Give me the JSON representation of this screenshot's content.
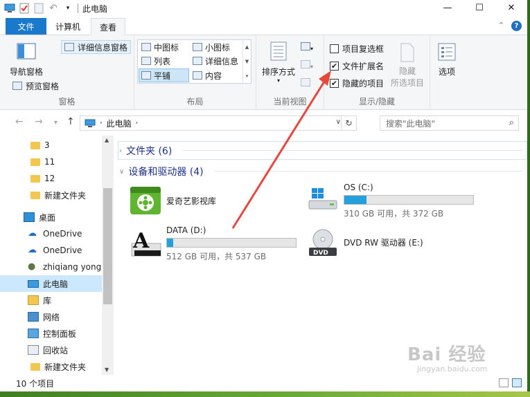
{
  "window": {
    "title": "此电脑",
    "controls": {
      "minimize": "—",
      "maximize": "☐",
      "close": "✕"
    }
  },
  "tabs": {
    "file": "文件",
    "items": [
      "计算机",
      "查看"
    ],
    "active": "查看",
    "collapse": "⌃",
    "help": "?"
  },
  "ribbon": {
    "pane_group": {
      "label": "窗格",
      "nav_pane": "导航窗格",
      "preview_pane": "预览窗格",
      "details_pane": "详细信息窗格"
    },
    "layout_group": {
      "label": "布局",
      "items": [
        "中图标",
        "小图标",
        "列表",
        "详细信息",
        "平铺",
        "内容"
      ],
      "selected": "平铺"
    },
    "current_view_group": {
      "label": "当前视图",
      "sort_by": "排序方式"
    },
    "show_hide_group": {
      "label": "显示/隐藏",
      "item_checkboxes": {
        "label": "项目复选框",
        "checked": false
      },
      "file_extensions": {
        "label": "文件扩展名",
        "checked": true
      },
      "hidden_items": {
        "label": "隐藏的项目",
        "checked": true
      },
      "hide_selected_1": "隐藏",
      "hide_selected_2": "所选项目"
    },
    "options": "选项"
  },
  "address": {
    "location": "此电脑",
    "search_placeholder": "搜索\"此电脑\""
  },
  "nav_pane": {
    "items": [
      {
        "label": "3",
        "icon": "folder-icon"
      },
      {
        "label": "11",
        "icon": "folder-icon"
      },
      {
        "label": "12",
        "icon": "folder-icon"
      },
      {
        "label": "新建文件夹",
        "icon": "folder-icon"
      },
      {
        "label": "桌面",
        "icon": "desktop-icon"
      },
      {
        "label": "OneDrive",
        "icon": "cloud-icon"
      },
      {
        "label": "OneDrive",
        "icon": "cloud-icon"
      },
      {
        "label": "zhiqiang yong",
        "icon": "user-icon"
      },
      {
        "label": "此电脑",
        "icon": "computer-icon",
        "selected": true
      },
      {
        "label": "库",
        "icon": "library-icon"
      },
      {
        "label": "网络",
        "icon": "network-icon"
      },
      {
        "label": "控制面板",
        "icon": "control-panel-icon"
      },
      {
        "label": "回收站",
        "icon": "recycle-bin-icon"
      },
      {
        "label": "新建文件夹",
        "icon": "folder-icon"
      }
    ]
  },
  "content": {
    "folders_section": "文件夹 (6)",
    "devices_section": "设备和驱动器 (4)",
    "drives": [
      {
        "name": "爱奇艺影视库",
        "icon": "iqiyi-icon"
      },
      {
        "name": "OS (C:)",
        "free": "310 GB 可用，共 372 GB",
        "used_fraction": 0.17,
        "icon": "windows-drive-icon"
      },
      {
        "name": "DATA (D:)",
        "free": "512 GB 可用，共 537 GB",
        "used_fraction": 0.05,
        "icon": "data-drive-icon"
      },
      {
        "name": "DVD RW 驱动器 (E:)",
        "icon": "dvd-drive-icon"
      }
    ]
  },
  "status": {
    "count": "10 个项目"
  },
  "watermark": {
    "main": "Bai 经验",
    "sub": "jingyan.baidu.com"
  },
  "colors": {
    "accent": "#1979ca",
    "selection": "#cce8ff",
    "bar_fill": "#26a0da",
    "annotation_arrow": "#e8473c"
  }
}
